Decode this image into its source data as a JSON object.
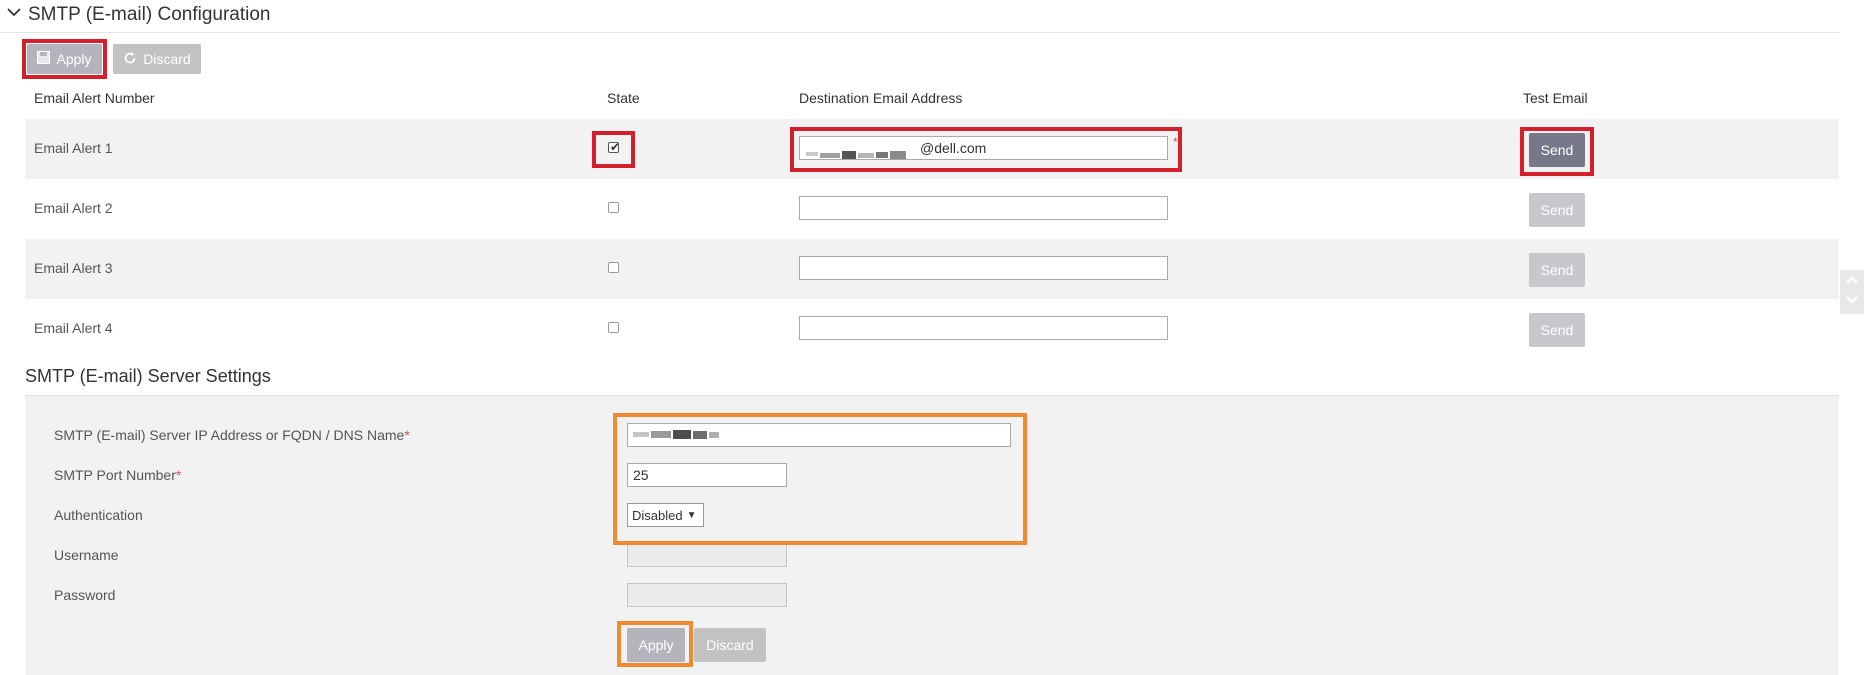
{
  "section1": {
    "title": "SMTP (E-mail) Configuration",
    "toolbar": {
      "apply_label": "Apply",
      "discard_label": "Discard"
    }
  },
  "table": {
    "headers": [
      "Email Alert Number",
      "State",
      "Destination Email Address",
      "Test Email"
    ],
    "rows": [
      {
        "label": "Email Alert 1",
        "checked": true,
        "email": "@dell.com",
        "required_mark": "*",
        "send_label": "Send",
        "send_active": true
      },
      {
        "label": "Email Alert 2",
        "checked": false,
        "email": "",
        "send_label": "Send",
        "send_active": false
      },
      {
        "label": "Email Alert 3",
        "checked": false,
        "email": "",
        "send_label": "Send",
        "send_active": false
      },
      {
        "label": "Email Alert 4",
        "checked": false,
        "email": "",
        "send_label": "Send",
        "send_active": false
      }
    ]
  },
  "section2": {
    "title": "SMTP (E-mail) Server Settings",
    "fields": {
      "server_label": "SMTP (E-mail) Server IP Address or FQDN / DNS Name",
      "port_label": "SMTP Port Number",
      "port_value": "25",
      "auth_label": "Authentication",
      "auth_value": "Disabled",
      "username_label": "Username",
      "password_label": "Password",
      "required_mark": "*"
    },
    "apply_label": "Apply",
    "discard_label": "Discard"
  },
  "colors": {
    "highlight_red": "#d3202a",
    "highlight_orange": "#f08a30",
    "send_active": "#77778a",
    "send_disabled": "#c7c7cd"
  },
  "icons": [
    "chevron-down-icon",
    "save-icon",
    "refresh-icon",
    "checkmark-icon",
    "scroll-up-icon",
    "scroll-down-icon"
  ]
}
